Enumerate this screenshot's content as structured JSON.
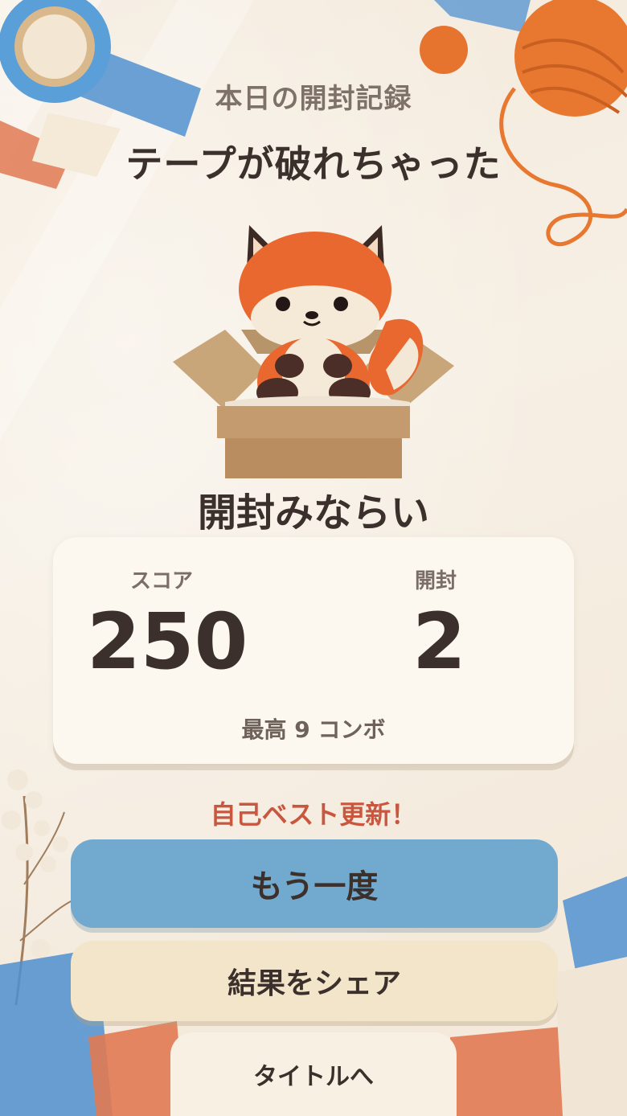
{
  "header": {
    "subtitle": "本日の開封記録",
    "title": "テープが破れちゃった"
  },
  "hero": {
    "character": "fox-in-box"
  },
  "rank": "開封みならい",
  "stats": {
    "score_label": "スコア",
    "score_value": "250",
    "open_label": "開封",
    "open_value": "2",
    "combo_text": "最高 9 コンボ"
  },
  "best_text": "自己ベスト更新！",
  "buttons": {
    "retry": "もう一度",
    "share": "結果をシェア",
    "title": "タイトルへ"
  },
  "colors": {
    "retry_button": "#72a9cf",
    "share_button": "#f3e5c9",
    "best_text": "#c9573f",
    "fox": "#e8682f"
  }
}
